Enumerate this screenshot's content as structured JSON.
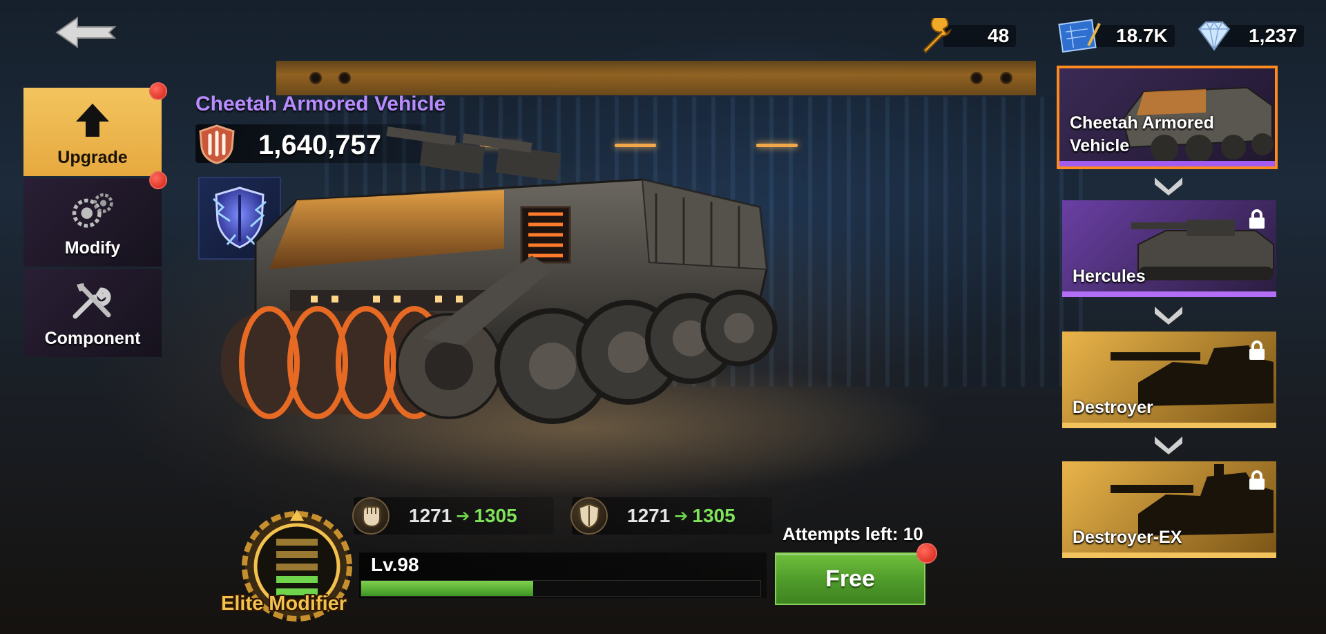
{
  "resources": {
    "wrench": {
      "icon": "wrench-icon",
      "value": "48"
    },
    "blueprint": {
      "icon": "blueprint-icon",
      "value": "18.7K"
    },
    "diamond": {
      "icon": "diamond-icon",
      "value": "1,237"
    }
  },
  "menu": [
    {
      "id": "upgrade",
      "label": "Upgrade",
      "icon": "up-arrow-icon",
      "active": true,
      "notify": true
    },
    {
      "id": "modify",
      "label": "Modify",
      "icon": "gears-icon",
      "active": false,
      "notify": true
    },
    {
      "id": "component",
      "label": "Component",
      "icon": "tools-icon",
      "active": false,
      "notify": false
    }
  ],
  "vehicle": {
    "name": "Cheetah Armored Vehicle",
    "power": "1,640,757",
    "power_icon": "power-shield-icon",
    "skill_icon": "lightning-shield-icon"
  },
  "stats": {
    "attack": {
      "icon": "fist-icon",
      "from": "1271",
      "to": "1305"
    },
    "defense": {
      "icon": "shield-icon",
      "from": "1271",
      "to": "1305"
    }
  },
  "level": {
    "label": "Lv.98",
    "progress": 0.43
  },
  "elite": {
    "label": "Elite Modifier"
  },
  "action": {
    "attempts_label": "Attempts left: 10",
    "free_label": "Free"
  },
  "evolution": [
    {
      "name_line1": "Cheetah Armored",
      "name_line2": "Vehicle",
      "locked": false,
      "selected": true
    },
    {
      "name_line1": "Hercules",
      "name_line2": "",
      "locked": true,
      "selected": false
    },
    {
      "name_line1": "Destroyer",
      "name_line2": "",
      "locked": true,
      "selected": false
    },
    {
      "name_line1": "Destroyer-EX",
      "name_line2": "",
      "locked": true,
      "selected": false
    }
  ],
  "colors": {
    "accent_gold": "#f3c45e",
    "vehicle_name": "#b98cff",
    "upgrade_green": "#7ee35a",
    "selected_border": "#ff8a1e"
  }
}
